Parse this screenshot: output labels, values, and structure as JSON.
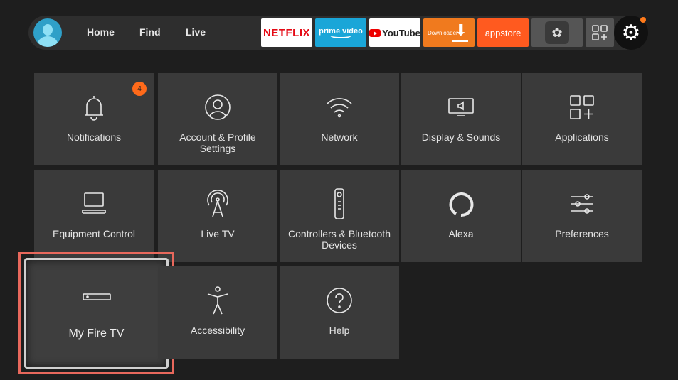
{
  "nav": {
    "home": "Home",
    "find": "Find",
    "live": "Live"
  },
  "apps": {
    "netflix": "NETFLIX",
    "prime": "prime video",
    "youtube": "YouTube",
    "downloader": "Downloader",
    "appstore": "appstore"
  },
  "colors": {
    "accent": "#ff6a1a",
    "focus_outline": "#e8685c",
    "tile_bg": "#3a3a3a"
  },
  "tiles": [
    {
      "label": "Notifications",
      "icon": "bell-icon",
      "badge": "4"
    },
    {
      "label": "Account & Profile Settings",
      "icon": "profile-icon"
    },
    {
      "label": "Network",
      "icon": "wifi-icon"
    },
    {
      "label": "Display & Sounds",
      "icon": "display-sound-icon"
    },
    {
      "label": "Applications",
      "icon": "apps-grid-icon"
    },
    {
      "label": "Equipment Control",
      "icon": "equipment-icon"
    },
    {
      "label": "Live TV",
      "icon": "antenna-icon"
    },
    {
      "label": "Controllers & Bluetooth Devices",
      "icon": "remote-icon"
    },
    {
      "label": "Alexa",
      "icon": "alexa-icon"
    },
    {
      "label": "Preferences",
      "icon": "sliders-icon"
    },
    {
      "label": "My Fire TV",
      "icon": "fire-tv-stick-icon",
      "focused": true
    },
    {
      "label": "Accessibility",
      "icon": "accessibility-icon"
    },
    {
      "label": "Help",
      "icon": "help-icon"
    }
  ]
}
